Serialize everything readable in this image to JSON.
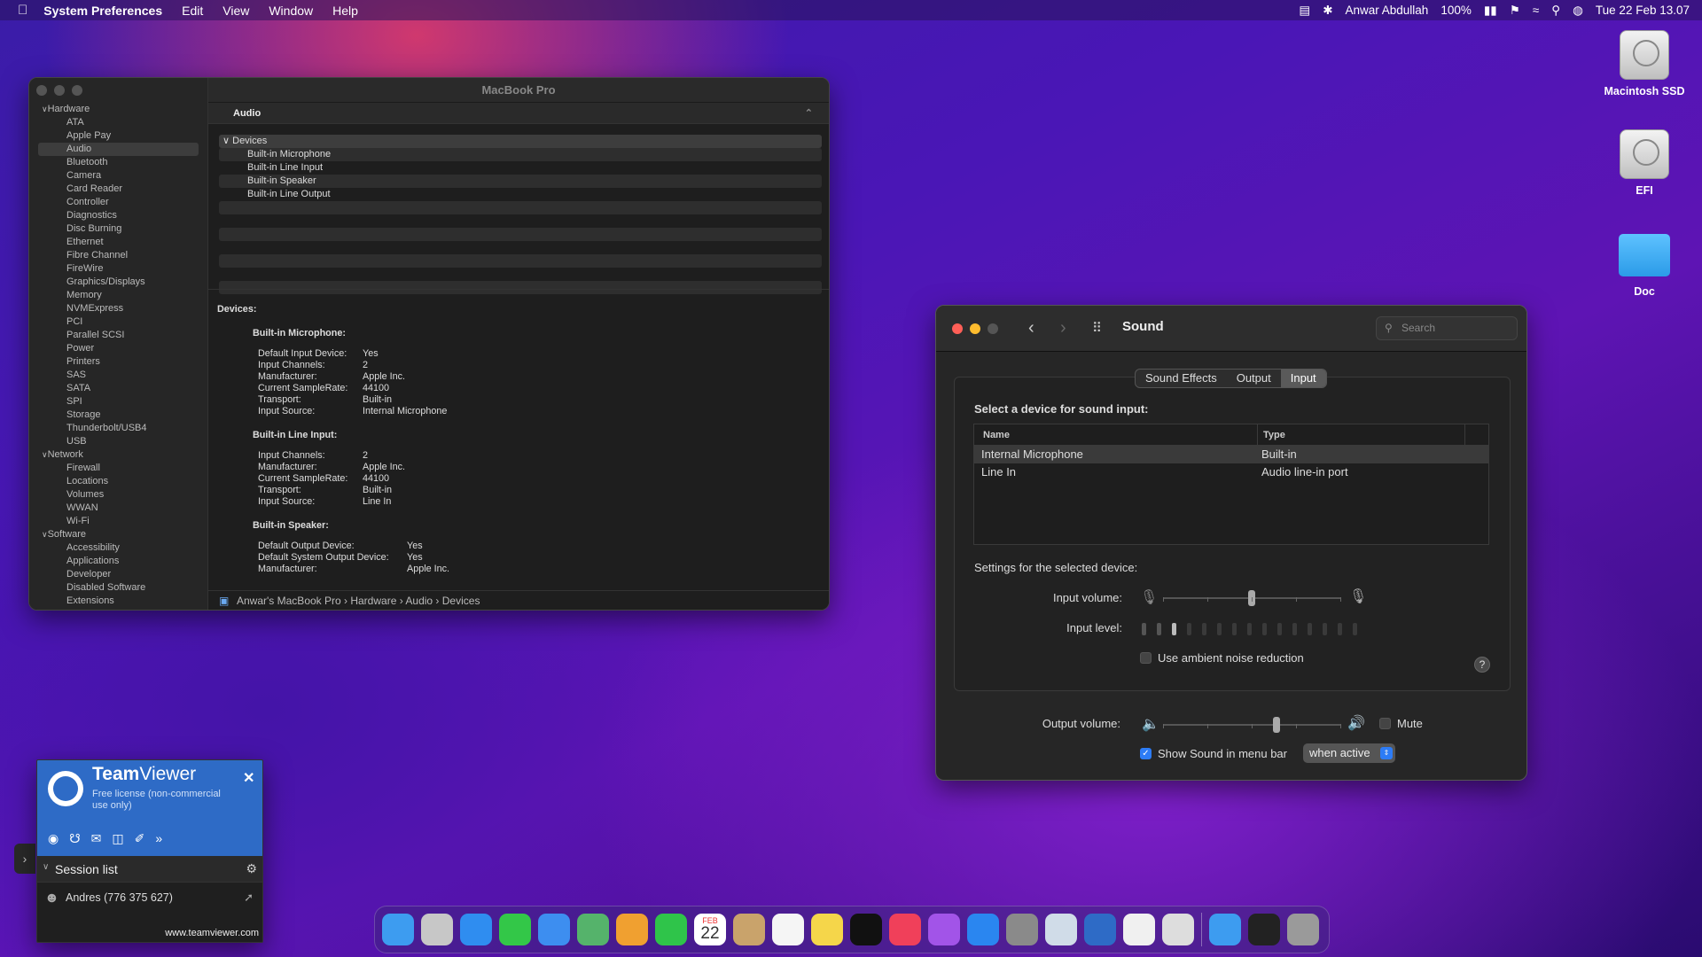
{
  "menubar": {
    "app": "System Preferences",
    "items": [
      "Edit",
      "View",
      "Window",
      "Help"
    ],
    "user": "Anwar Abdullah",
    "battery": "100%",
    "datetime": "Tue 22 Feb 13.07",
    "apple_icon": "apple-icon"
  },
  "desktop": {
    "icons": [
      {
        "label": "Macintosh SSD"
      },
      {
        "label": "EFI"
      },
      {
        "label": "Doc"
      }
    ]
  },
  "sysinfo": {
    "title": "MacBook Pro",
    "section_header": "Audio",
    "sidebar": [
      {
        "group": "Hardware",
        "items": [
          "ATA",
          "Apple Pay",
          "Audio",
          "Bluetooth",
          "Camera",
          "Card Reader",
          "Controller",
          "Diagnostics",
          "Disc Burning",
          "Ethernet",
          "Fibre Channel",
          "FireWire",
          "Graphics/Displays",
          "Memory",
          "NVMExpress",
          "PCI",
          "Parallel SCSI",
          "Power",
          "Printers",
          "SAS",
          "SATA",
          "SPI",
          "Storage",
          "Thunderbolt/USB4",
          "USB"
        ]
      },
      {
        "group": "Network",
        "items": [
          "Firewall",
          "Locations",
          "Volumes",
          "WWAN",
          "Wi-Fi"
        ]
      },
      {
        "group": "Software",
        "items": [
          "Accessibility",
          "Applications",
          "Developer",
          "Disabled Software",
          "Extensions"
        ]
      }
    ],
    "selected": "Audio",
    "list": {
      "group": "Devices",
      "items": [
        "Built-in Microphone",
        "Built-in Line Input",
        "Built-in Speaker",
        "Built-in Line Output"
      ]
    },
    "detail": {
      "heading": "Devices:",
      "sections": [
        {
          "title": "Built-in Microphone:",
          "rows": [
            [
              "Default Input Device:",
              "Yes"
            ],
            [
              "Input Channels:",
              "2"
            ],
            [
              "Manufacturer:",
              "Apple Inc."
            ],
            [
              "Current SampleRate:",
              "44100"
            ],
            [
              "Transport:",
              "Built-in"
            ],
            [
              "Input Source:",
              "Internal Microphone"
            ]
          ]
        },
        {
          "title": "Built-in Line Input:",
          "rows": [
            [
              "Input Channels:",
              "2"
            ],
            [
              "Manufacturer:",
              "Apple Inc."
            ],
            [
              "Current SampleRate:",
              "44100"
            ],
            [
              "Transport:",
              "Built-in"
            ],
            [
              "Input Source:",
              "Line In"
            ]
          ]
        },
        {
          "title": "Built-in Speaker:",
          "rows": [
            [
              "Default Output Device:",
              "Yes"
            ],
            [
              "Default System Output Device:",
              "Yes"
            ],
            [
              "Manufacturer:",
              "Apple Inc."
            ]
          ]
        }
      ]
    },
    "path": [
      "Anwar's MacBook Pro",
      "Hardware",
      "Audio",
      "Devices"
    ]
  },
  "sound": {
    "title": "Sound",
    "search_placeholder": "Search",
    "tabs": [
      "Sound Effects",
      "Output",
      "Input"
    ],
    "active_tab": "Input",
    "select_label": "Select a device for sound input:",
    "columns": [
      "Name",
      "Type"
    ],
    "devices": [
      {
        "name": "Internal Microphone",
        "type": "Built-in"
      },
      {
        "name": "Line In",
        "type": "Audio line-in port"
      }
    ],
    "settings_label": "Settings for the selected device:",
    "input_volume_label": "Input volume:",
    "input_volume": 0.5,
    "input_level_label": "Input level:",
    "input_level_active": 3,
    "input_level_total": 15,
    "ambient_label": "Use ambient noise reduction",
    "ambient_checked": false,
    "help": "?",
    "output_volume_label": "Output volume:",
    "output_volume": 0.64,
    "mute_label": "Mute",
    "menubar_label": "Show Sound in menu bar",
    "menubar_checked": true,
    "menubar_option": "when active"
  },
  "teamviewer": {
    "brand_a": "Team",
    "brand_b": "Viewer",
    "license": "Free license (non-commercial use only)",
    "session_list": "Session list",
    "contact": "Andres (776 375 627)",
    "url": "www.teamviewer.com"
  },
  "dock": {
    "apps": [
      "Finder",
      "Launchpad",
      "Safari",
      "Messages",
      "Mail",
      "Maps",
      "Photos",
      "FaceTime",
      "Calendar",
      "Contacts",
      "Reminders",
      "Notes",
      "TV",
      "Music",
      "Podcasts",
      "App Store",
      "System Preferences",
      "Preview",
      "TeamViewer",
      "TextEdit",
      "Printer",
      "Downloads",
      "Terminal",
      "Trash"
    ],
    "calendar_month": "FEB",
    "calendar_day": "22",
    "colors": [
      "#3d9cf0",
      "#c7c7c7",
      "#2f8df0",
      "#33c748",
      "#3d8ef0",
      "#55b36b",
      "#f0a030",
      "#2fc44a",
      "#ffffff",
      "#c9a36b",
      "#f5f5f5",
      "#f5d64a",
      "#111111",
      "#f0405a",
      "#a254e8",
      "#2a86f0",
      "#8a8a8a",
      "#d0dce8",
      "#2e6bc6",
      "#f0f0f0",
      "#dddddd",
      "#3d9cf0",
      "#222222",
      "#9a9a9a"
    ]
  }
}
